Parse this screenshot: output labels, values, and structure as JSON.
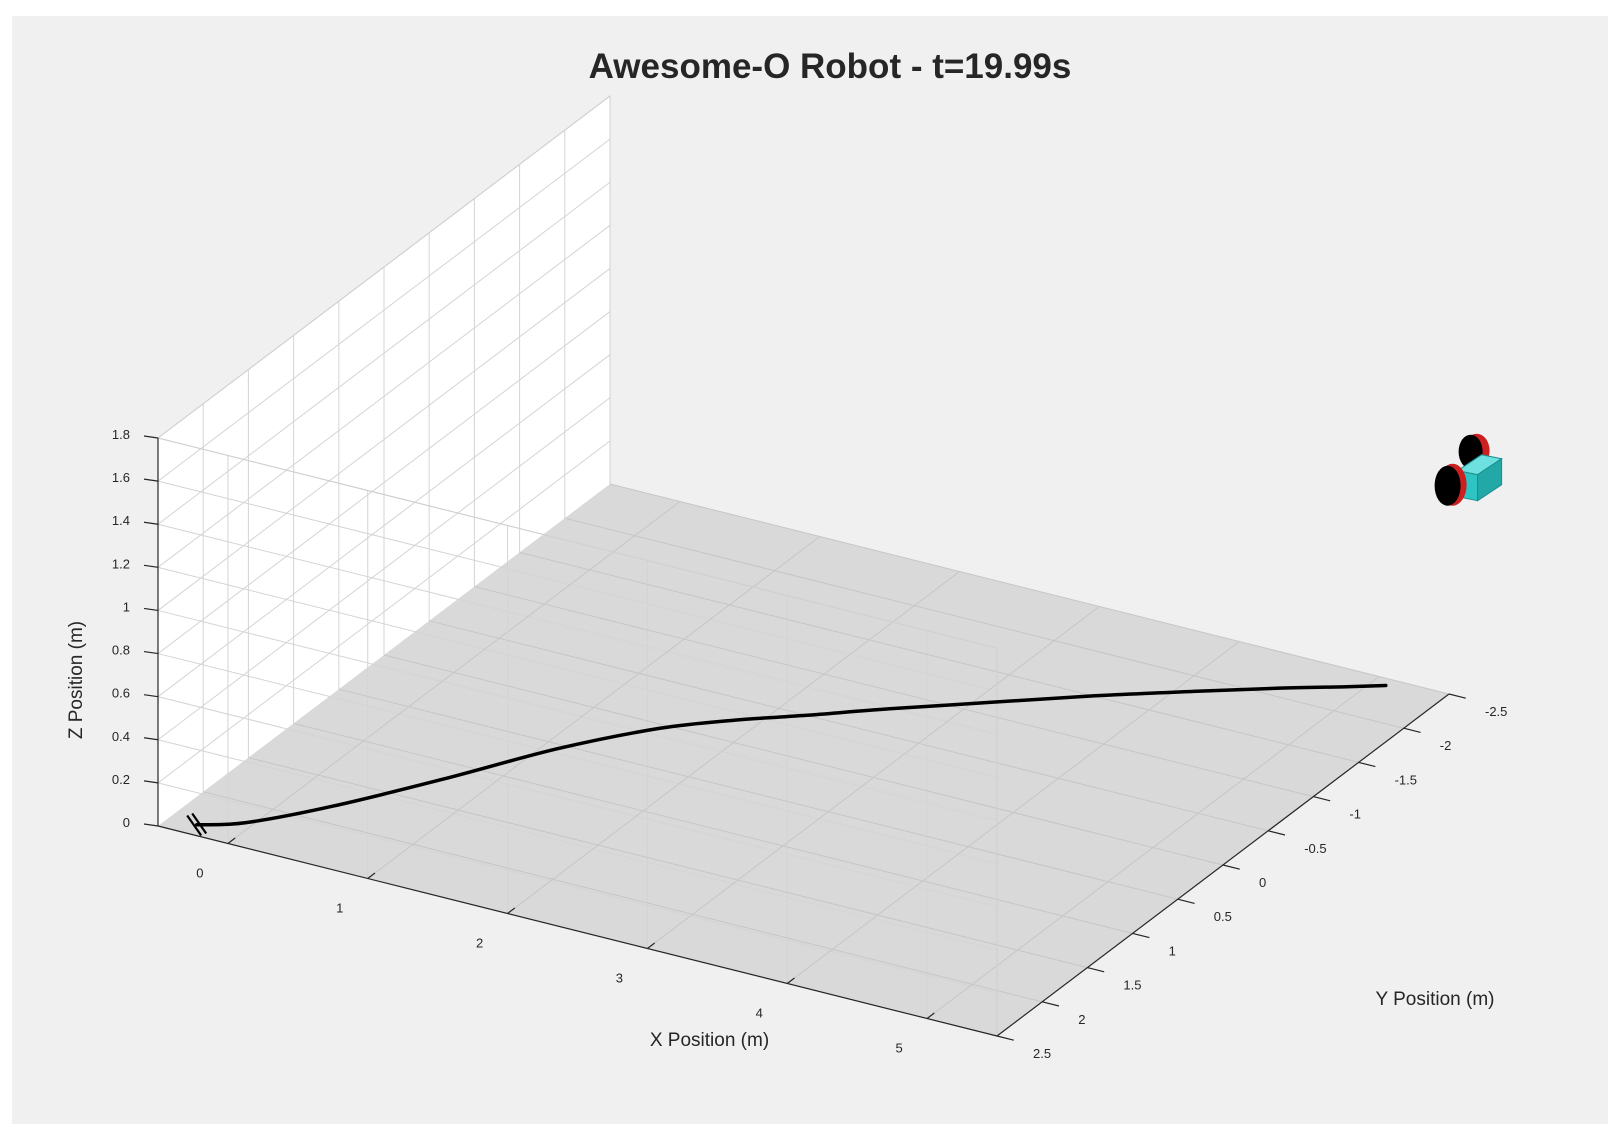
{
  "chart_data": {
    "type": "line",
    "title": "Awesome-O Robot - t=19.99s",
    "xlabel": "X Position (m)",
    "ylabel": "Y Position (m)",
    "zlabel": "Z Position (m)",
    "xlim": [
      -0.5,
      5.5
    ],
    "ylim": [
      -2.5,
      2.5
    ],
    "zlim": [
      0,
      1.8
    ],
    "x_ticks": [
      "0",
      "1",
      "2",
      "3",
      "4",
      "5"
    ],
    "y_ticks": [
      "-2.5",
      "-2",
      "-1.5",
      "-1",
      "-0.5",
      "0",
      "0.5",
      "1",
      "1.5",
      "2",
      "2.5"
    ],
    "z_ticks": [
      "0",
      "0.2",
      "0.4",
      "0.6",
      "0.8",
      "1",
      "1.2",
      "1.4",
      "1.6",
      "1.8"
    ],
    "grid": true,
    "series": [
      {
        "x": [
          -0.3,
          -0.05,
          0.3,
          0.7,
          1.1,
          1.5,
          1.85,
          2.2,
          2.6,
          3.1,
          3.6,
          4.1,
          4.55,
          4.9,
          5.1
        ],
        "y": [
          2.38,
          2.22,
          1.8,
          1.2,
          0.55,
          0.05,
          -0.25,
          -0.5,
          -0.8,
          -1.15,
          -1.5,
          -1.82,
          -2.1,
          -2.3,
          -2.42
        ],
        "z": [
          0.05,
          0.05,
          0.05,
          0.05,
          0.05,
          0.05,
          0.05,
          0.05,
          0.05,
          0.05,
          0.05,
          0.05,
          0.05,
          0.05,
          0.05
        ],
        "color": "#000000"
      }
    ],
    "robot": {
      "x": 5.3,
      "y": -2.75,
      "z": 0.85,
      "body_color": "#2ec4c4",
      "wheel_color": "#000000",
      "wheel_rim_color": "#cc1f1f"
    },
    "start_marker": {
      "x": -0.3,
      "y": 2.42
    },
    "floor_color": "#d9d9d9",
    "wall_color": "#ffffff",
    "background_color": "#f0f0f0"
  }
}
